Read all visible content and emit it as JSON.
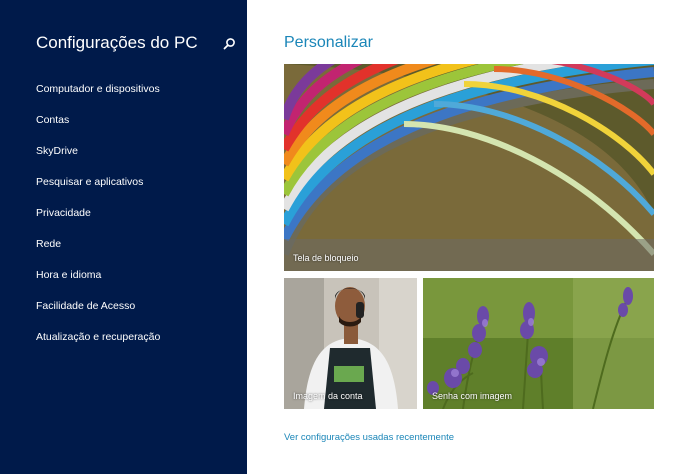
{
  "sidebar": {
    "title": "Configurações do PC",
    "search_icon": "search-icon",
    "items": [
      {
        "label": "Computador e dispositivos"
      },
      {
        "label": "Contas"
      },
      {
        "label": "SkyDrive"
      },
      {
        "label": "Pesquisar e aplicativos"
      },
      {
        "label": "Privacidade"
      },
      {
        "label": "Rede"
      },
      {
        "label": "Hora e idioma"
      },
      {
        "label": "Facilidade de Acesso"
      },
      {
        "label": "Atualização e recuperação"
      }
    ]
  },
  "main": {
    "title": "Personalizar",
    "tiles": {
      "lock_screen": {
        "label": "Tela de bloqueio"
      },
      "account_picture": {
        "label": "Imagem da conta"
      },
      "picture_password": {
        "label": "Senha com imagem"
      }
    },
    "recent_link": "Ver configurações usadas recentemente"
  },
  "colors": {
    "sidebar_bg": "#001a4a",
    "accent": "#1b86b8",
    "main_bg": "#ffffff"
  }
}
